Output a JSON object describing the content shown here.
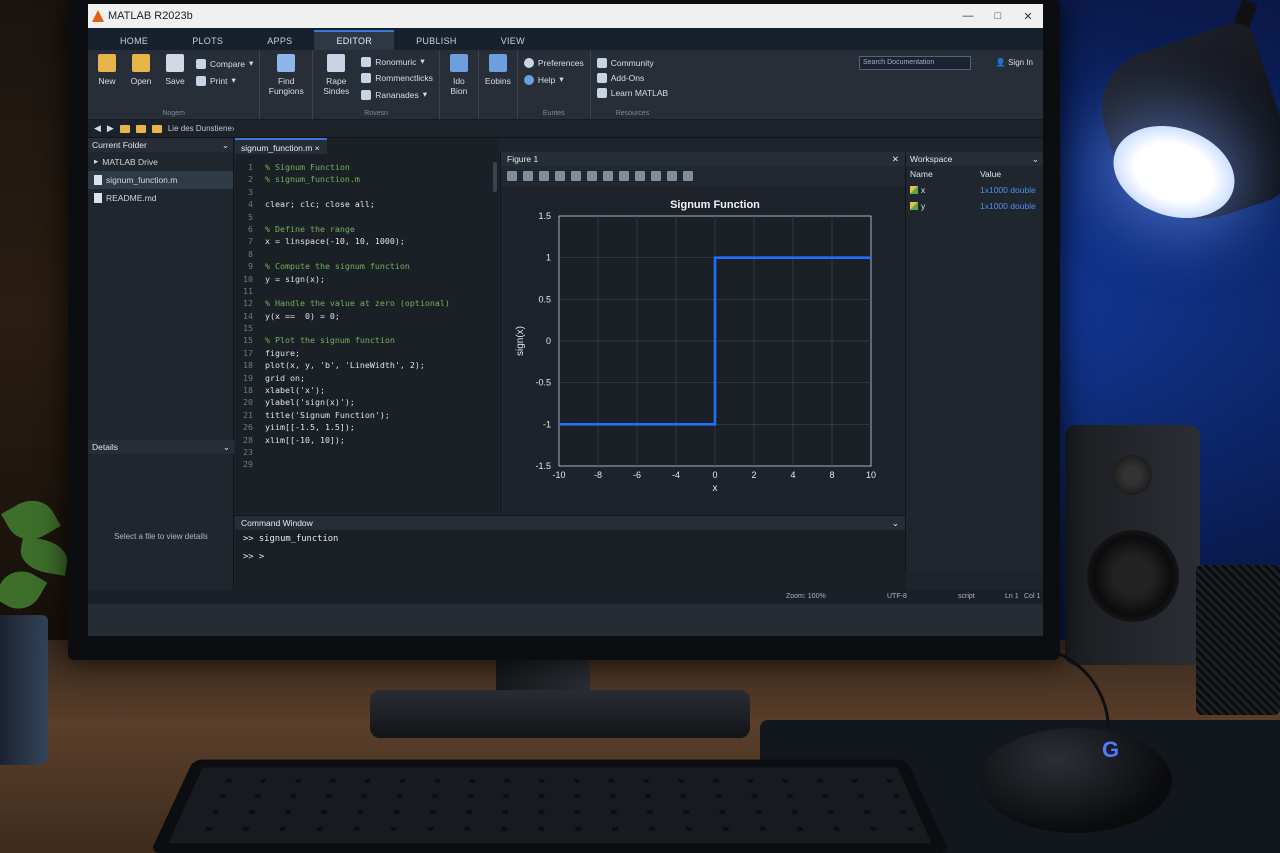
{
  "window": {
    "title": "MATLAB R2023b",
    "controls": [
      "—",
      "□",
      "✕"
    ]
  },
  "ribbon_tabs": [
    "HOME",
    "PLOTS",
    "APPS",
    "EDITOR",
    "PUBLISH",
    "VIEW"
  ],
  "ribbon": {
    "new": "New",
    "open": "Open",
    "save": "Save",
    "compare": "Compare",
    "print": "Print",
    "file_group": "Nogem",
    "find": "Find",
    "find_sub": "Fungions",
    "refactor": "Rape",
    "refactor_sub": "Sindes",
    "r1": "Ronomuric",
    "r2": "Rommenctlicks",
    "r3": "Rananades",
    "nav_group": "Rovesn",
    "run": "Ido",
    "run_sub": "Bion",
    "tools": "Eobins",
    "preferences": "Preferences",
    "help": "Help",
    "env_group": "Euntes",
    "community": "Community",
    "addons": "Add-Ons",
    "learn": "Learn MATLAB",
    "resources_group": "Resources",
    "search_placeholder": "Search Documentation",
    "signin": "Sign In"
  },
  "address": {
    "path": "Lie des Dunstiene›"
  },
  "current_folder": {
    "title": "Current Folder",
    "drive": "MATLAB Drive",
    "files": [
      "signum_function.m",
      "README.md"
    ]
  },
  "details": {
    "title": "Details",
    "message": "Select a file to view details"
  },
  "editor": {
    "tab": "signum_function.m",
    "lines": [
      {
        "n": "1",
        "t": "% Signum Function",
        "c": true
      },
      {
        "n": "2",
        "t": "% signum_function.m",
        "c": true
      },
      {
        "n": "3",
        "t": "",
        "c": false
      },
      {
        "n": "4",
        "t": "clear; clc; close all;",
        "c": false
      },
      {
        "n": "5",
        "t": "",
        "c": false
      },
      {
        "n": "6",
        "t": "% Define the range",
        "c": true
      },
      {
        "n": "7",
        "t": "x = linspace(-10, 10, 1000);",
        "c": false
      },
      {
        "n": "8",
        "t": "",
        "c": false
      },
      {
        "n": "9",
        "t": "% Compute the signum function",
        "c": true
      },
      {
        "n": "10",
        "t": "y = sign(x);",
        "c": false
      },
      {
        "n": "11",
        "t": "",
        "c": false
      },
      {
        "n": "12",
        "t": "% Handle the value at zero (optional)",
        "c": true
      },
      {
        "n": "14",
        "t": "y(x ==  0) = 0;",
        "c": false
      },
      {
        "n": "15",
        "t": "",
        "c": false
      },
      {
        "n": "15",
        "t": "% Plot the signum function",
        "c": true
      },
      {
        "n": "17",
        "t": "figure;",
        "c": false
      },
      {
        "n": "18",
        "t": "plot(x, y, 'b', 'LineWidth', 2);",
        "c": false
      },
      {
        "n": "19",
        "t": "grid on;",
        "c": false
      },
      {
        "n": "18",
        "t": "xlabel('x');",
        "c": false
      },
      {
        "n": "20",
        "t": "ylabel('sign(x)');",
        "c": false
      },
      {
        "n": "21",
        "t": "title('Signum Function');",
        "c": false
      },
      {
        "n": "26",
        "t": "yiim[[-1.5, 1.5]);",
        "c": false
      },
      {
        "n": "28",
        "t": "xlim[[-10, 10]);",
        "c": false
      },
      {
        "n": "23",
        "t": "",
        "c": false
      },
      {
        "n": "29",
        "t": "",
        "c": false
      }
    ]
  },
  "figure": {
    "title": "Figure 1"
  },
  "chart_data": {
    "type": "line",
    "title": "Signum Function",
    "xlabel": "x",
    "ylabel": "sign(x)",
    "xlim": [
      -10,
      10
    ],
    "ylim": [
      -1.5,
      1.5
    ],
    "xticks": [
      "-10",
      "-8",
      "-6",
      "-4",
      "0",
      "2",
      "4",
      "8",
      "10"
    ],
    "yticks": [
      "1.5",
      "1",
      "0.5",
      "0",
      "-0.5",
      "-1",
      "-1.5"
    ],
    "grid": true,
    "series": [
      {
        "color": "#1f6fff",
        "x": [
          -10,
          0,
          0,
          10
        ],
        "y": [
          -1,
          -1,
          1,
          1
        ]
      }
    ]
  },
  "workspace": {
    "title": "Workspace",
    "col_name": "Name",
    "col_value": "Value",
    "vars": [
      {
        "name": "x",
        "value": "1x1000 double"
      },
      {
        "name": "y",
        "value": "1x1000 double"
      }
    ]
  },
  "command_window": {
    "title": "Command Window",
    "line1": ">> signum_function",
    "line2": ">> >"
  },
  "status": {
    "zoom": "Zoom: 100%",
    "encoding": "UTF-8",
    "type": "script",
    "ln": "Ln 1",
    "col": "Col 1"
  }
}
